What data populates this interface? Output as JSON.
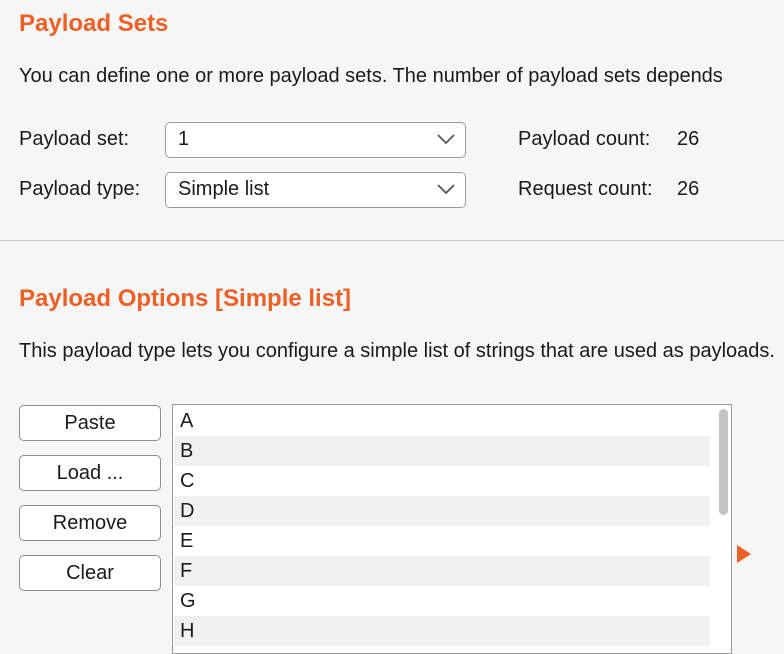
{
  "payload_sets": {
    "title": "Payload Sets",
    "description": "You can define one or more payload sets. The number of payload sets depends",
    "set_label": "Payload set:",
    "set_value": "1",
    "type_label": "Payload type:",
    "type_value": "Simple list",
    "payload_count_label": "Payload count:",
    "payload_count_value": "26",
    "request_count_label": "Request count:",
    "request_count_value": "26"
  },
  "payload_options": {
    "title": "Payload Options [Simple list]",
    "description": "This payload type lets you configure a simple list of strings that are used as payloads.",
    "buttons": {
      "paste": "Paste",
      "load": "Load ...",
      "remove": "Remove",
      "clear": "Clear"
    },
    "items": [
      "A",
      "B",
      "C",
      "D",
      "E",
      "F",
      "G",
      "H"
    ]
  },
  "colors": {
    "accent": "#ee5f25",
    "background": "#f6f6f6"
  },
  "icons": {
    "dropdown": "chevron-down-icon",
    "expand": "triangle-right-icon"
  }
}
